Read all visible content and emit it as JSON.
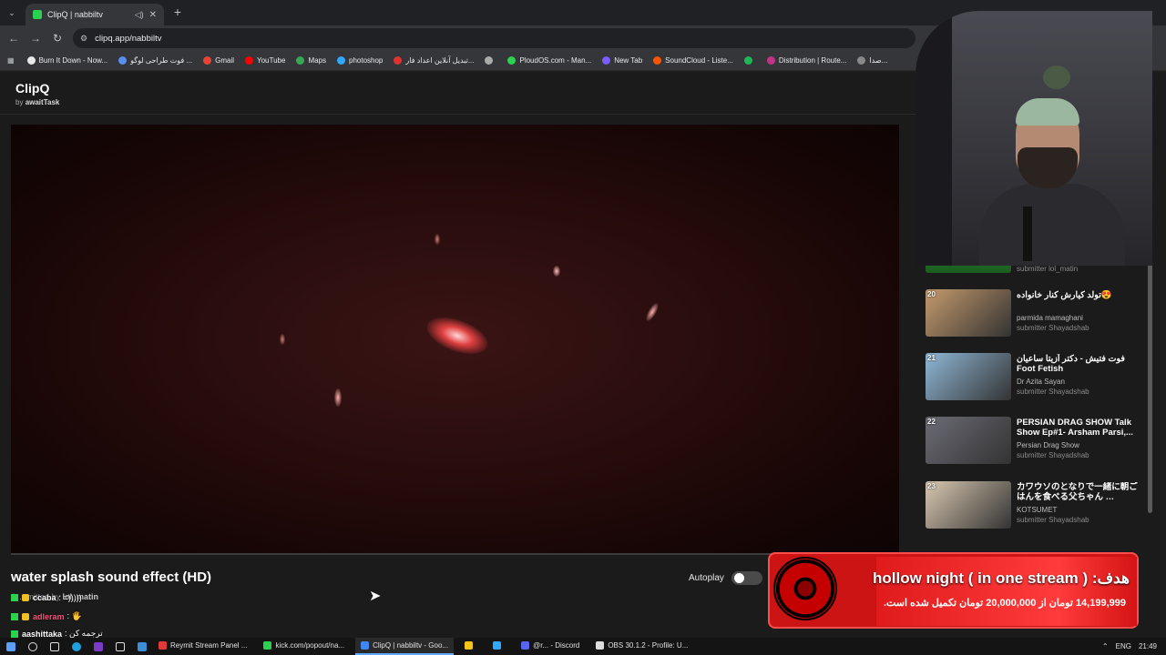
{
  "browser": {
    "tab_title": "ClipQ | nabbiltv",
    "url": "clipq.app/nabbiltv",
    "bookmarks": [
      {
        "label": "Burn It Down - Now...",
        "color": "#e8e8e8"
      },
      {
        "label": "فوت طراحی لوگو ...",
        "color": "#5b8def"
      },
      {
        "label": "Gmail",
        "color": "#ea4335"
      },
      {
        "label": "YouTube",
        "color": "#ff0000"
      },
      {
        "label": "Maps",
        "color": "#34a853"
      },
      {
        "label": "photoshop",
        "color": "#31a8ff"
      },
      {
        "label": "تبدیل آنلاین اعداد فار...",
        "color": "#d33"
      },
      {
        "label": "",
        "color": "#aaa"
      },
      {
        "label": "PloudOS.com - Man...",
        "color": "#2bd14f"
      },
      {
        "label": "New Tab",
        "color": "#7a5cff"
      },
      {
        "label": "SoundCloud - Liste...",
        "color": "#ff5500"
      },
      {
        "label": "",
        "color": "#1db954"
      },
      {
        "label": "Distribution | Route...",
        "color": "#c13584"
      },
      {
        "label": "صدا...",
        "color": "#888"
      }
    ]
  },
  "app": {
    "name": "ClipQ",
    "by_prefix": "by",
    "by_author": "awaitTask"
  },
  "clip": {
    "title": "water splash sound effect (HD)",
    "submitted_prefix": "A… mitted by",
    "submitter": "lol_matin",
    "autoplay_label": "Autoplay",
    "autoplay_on": false
  },
  "chat": [
    {
      "name": "ccaba",
      "message": ": =)))))"
    },
    {
      "name": "adleram",
      "message": ": 🖐"
    },
    {
      "name": "aashittaka",
      "message": ": ترجمه کن"
    }
  ],
  "queue": {
    "partial_top": {
      "submitter": "submitter lol_matin"
    },
    "items": [
      {
        "num": "20",
        "title": "تولد کیارش کنار خانواده😍",
        "channel": "parmida mamaghani",
        "submitter": "submitter Shayadshab",
        "thumb_color": "#c49a6c"
      },
      {
        "num": "21",
        "title": "فوت فتیش - دکتر آزیتا ساعیان Foot Fetish",
        "channel": "Dr Azita Sayan",
        "submitter": "submitter Shayadshab",
        "thumb_color": "#8fb7d6"
      },
      {
        "num": "22",
        "title": "PERSIAN DRAG SHOW Talk Show Ep#1- Arsham Parsi,...",
        "channel": "Persian Drag Show",
        "submitter": "submitter Shayadshab",
        "thumb_color": "#6b6b75"
      },
      {
        "num": "23",
        "title": "カワウソのとなりで一緒に朝ごはんを食べる父ちゃん …",
        "channel": "KOTSUMET",
        "submitter": "submitter Shayadshab",
        "thumb_color": "#d8c7b0"
      }
    ]
  },
  "goal": {
    "title": "هدف: ( hollow night ( in one stream",
    "amount": "14,199,999 تومان از 20,000,000 تومان تکمیل شده است."
  },
  "taskbar": {
    "apps": [
      {
        "label": "Reymit Stream Panel ...",
        "color": "#e23a3a",
        "active": false
      },
      {
        "label": "kick.com/popout/na...",
        "color": "#2bd14f",
        "active": false
      },
      {
        "label": "ClipQ | nabbiltv - Goo...",
        "color": "#4285f4",
        "active": true
      },
      {
        "label": "",
        "color": "#f5c518",
        "active": false
      },
      {
        "label": "",
        "color": "#31a8ff",
        "active": false
      },
      {
        "label": "@r... - Discord",
        "color": "#5865f2",
        "active": false
      },
      {
        "label": "OBS 30.1.2 - Profile: U...",
        "color": "#dddddd",
        "active": false
      }
    ],
    "language": "ENG",
    "time": "21:49"
  },
  "colors": {
    "goal_red": "#cc1414",
    "accent_green": "#2bd14f"
  }
}
